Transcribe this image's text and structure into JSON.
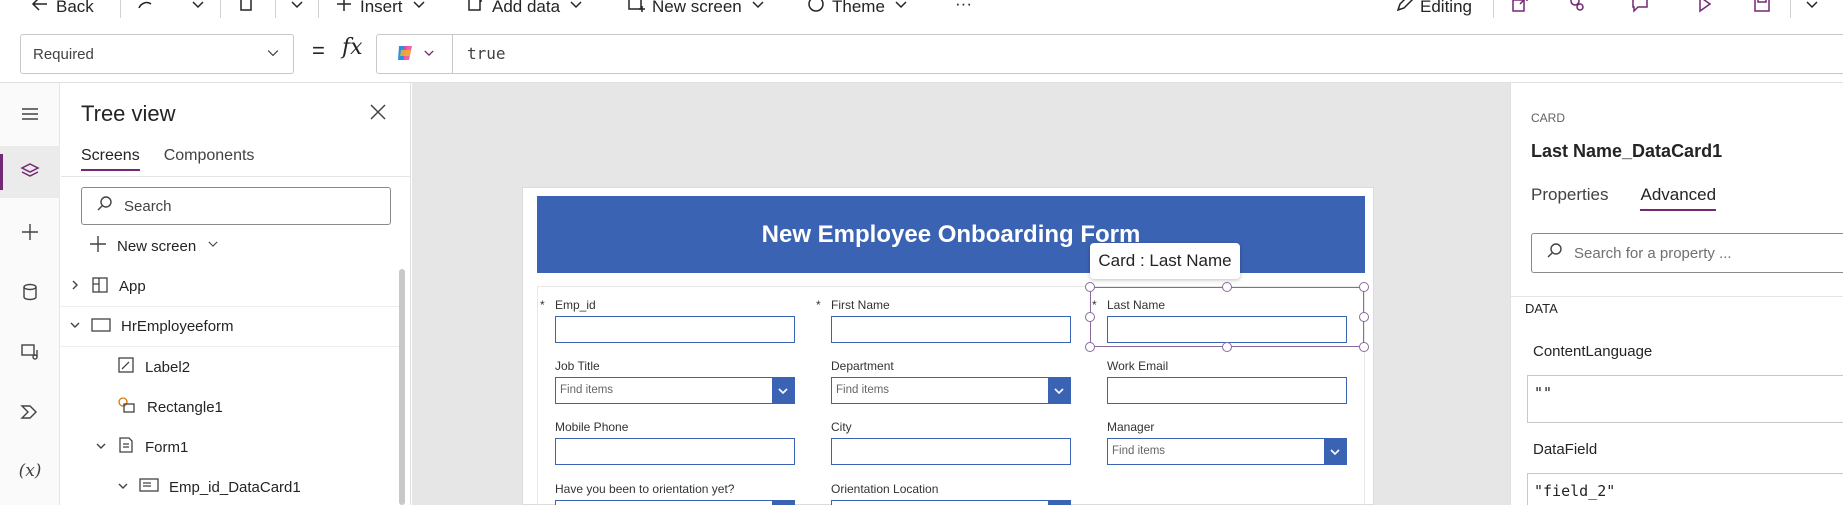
{
  "command_bar": {
    "back": "Back",
    "insert": "Insert",
    "add_data": "Add data",
    "new_screen": "New screen",
    "theme": "Theme",
    "more": "···",
    "editing": "Editing"
  },
  "formula_bar": {
    "property": "Required",
    "equals": "=",
    "fx": "fx",
    "formula": "true"
  },
  "tree": {
    "title": "Tree view",
    "tabs": [
      "Screens",
      "Components"
    ],
    "search_placeholder": "Search",
    "new_screen": "New screen",
    "nodes": [
      "App",
      "HrEmployeeform",
      "Label2",
      "Rectangle1",
      "Form1",
      "Emp_id_DataCard1"
    ]
  },
  "form": {
    "title": "New Employee Onboarding Form",
    "required_marker": "*",
    "tooltip": "Card : Last Name",
    "dropdown_placeholder": "Find items",
    "fields": {
      "emp_id": "Emp_id",
      "first_name": "First Name",
      "last_name": "Last Name",
      "job_title": "Job Title",
      "department": "Department",
      "work_email": "Work Email",
      "mobile_phone": "Mobile Phone",
      "city": "City",
      "manager": "Manager",
      "orientation": "Have you been to orientation yet?",
      "orientation_location": "Orientation Location"
    }
  },
  "properties_panel": {
    "kind": "CARD",
    "name": "Last Name_DataCard1",
    "tabs": [
      "Properties",
      "Advanced"
    ],
    "search_placeholder": "Search for a property ...",
    "section": "DATA",
    "props": [
      {
        "name": "ContentLanguage",
        "value": "\"\""
      },
      {
        "name": "DataField",
        "value": "\"field_2\""
      }
    ]
  },
  "colors": {
    "accent": "#742774",
    "form_blue": "#3b63b3"
  }
}
